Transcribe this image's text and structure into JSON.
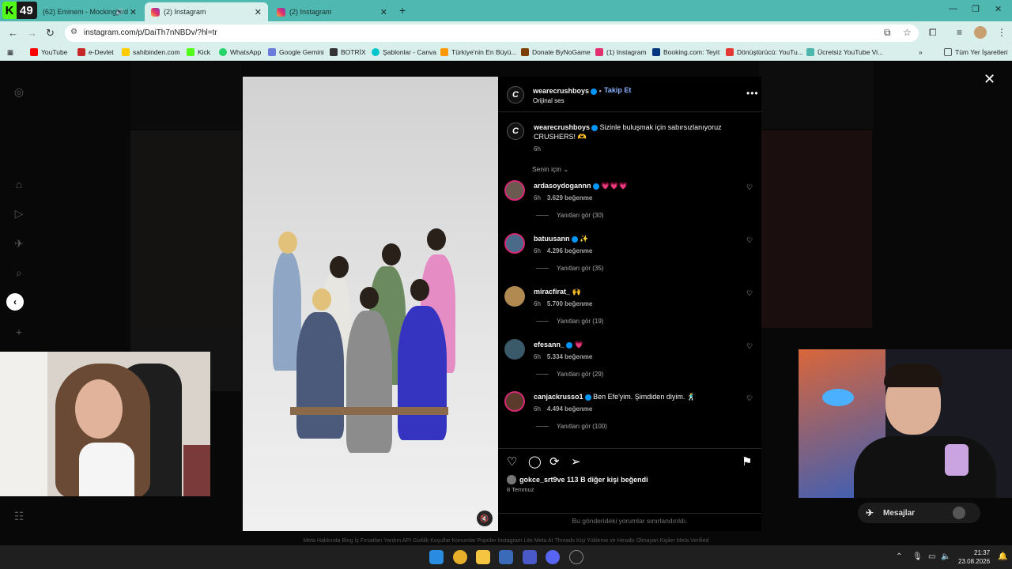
{
  "browser": {
    "kick_badge": {
      "letter": "K",
      "number": "49"
    },
    "tabs": [
      {
        "title": "(62) Eminem - Mockingbird",
        "active": false
      },
      {
        "title": "(2) Instagram",
        "active": true
      },
      {
        "title": "(2) Instagram",
        "active": false
      }
    ],
    "url": "instagram.com/p/DaiTh7nNBDv/?hl=tr",
    "bookmarks": [
      {
        "label": "YouTube",
        "color": "#ff0000"
      },
      {
        "label": "e-Devlet",
        "color": "#c62828"
      },
      {
        "label": "sahibinden.com",
        "color": "#ffcc00"
      },
      {
        "label": "Kick",
        "color": "#53fc18"
      },
      {
        "label": "WhatsApp",
        "color": "#25d366"
      },
      {
        "label": "Google Gemini",
        "color": "#6a7bd9"
      },
      {
        "label": "BOTRİX",
        "color": "#333333"
      },
      {
        "label": "Şablonlar - Canva",
        "color": "#00c4cc"
      },
      {
        "label": "Türkiye'nin En Büyü...",
        "color": "#ff9800"
      },
      {
        "label": "Donate ByNoGame",
        "color": "#7b3f00"
      },
      {
        "label": "(1) Instagram",
        "color": "#e1306c"
      },
      {
        "label": "Booking.com: Teyit",
        "color": "#003580"
      },
      {
        "label": "Dönüştürücü: YouTu...",
        "color": "#e53935"
      },
      {
        "label": "Ücretsiz YouTube Vi...",
        "color": "#4db6ac"
      }
    ],
    "all_bookmarks": "Tüm Yer İşaretleri"
  },
  "post": {
    "author": "wearecrushboys",
    "follow_label": "Takip Et",
    "audio": "Orijinal ses",
    "caption_text": "Sizinle buluşmak için sabırsızlanıyoruz CRUSHERS! 🫶",
    "caption_time": "6h",
    "sort_label": "Senin için",
    "likes_user": "gokce_srt9",
    "likes_rest": " ve 113 B diğer kişi beğendi",
    "date": "8 Temmuz",
    "comments_limited": "Bu gönderideki yorumlar sınırlandırıldı."
  },
  "comments": [
    {
      "user": "ardasoydogannn",
      "text": "💗💗💗",
      "time": "6h",
      "likes": "3.629 beğenme",
      "replies": "Yanıtları gör (30)"
    },
    {
      "user": "batuusann",
      "text": "✨",
      "time": "6h",
      "likes": "4.296 beğenme",
      "replies": "Yanıtları gör (35)"
    },
    {
      "user": "miracfirat_",
      "text": "🙌",
      "time": "6h",
      "likes": "5.700 beğenme",
      "replies": "Yanıtları gör (19)"
    },
    {
      "user": "efesann_",
      "text": "💗",
      "time": "6h",
      "likes": "5.334 beğenme",
      "replies": "Yanıtları gör (29)"
    },
    {
      "user": "canjackrusso1",
      "text": "Ben Efe'yim. Şimdiden diyim. 🕺",
      "time": "6h",
      "likes": "4.494 beğenme",
      "replies": "Yanıtları gör (100)"
    }
  ],
  "messages_label": "Mesajlar",
  "footer": "Meta   Hakkında   Blog   İş Fırsatları   Yardım   API   Gizlilik   Koşullar   Konumlar   Popüler   Instagram Lite   Meta AI   Threads   Kişi Yükleme ve Hesabı Olmayan Kişiler   Meta Verified",
  "clock": {
    "time": "21:37",
    "date": "23.08.2026"
  }
}
